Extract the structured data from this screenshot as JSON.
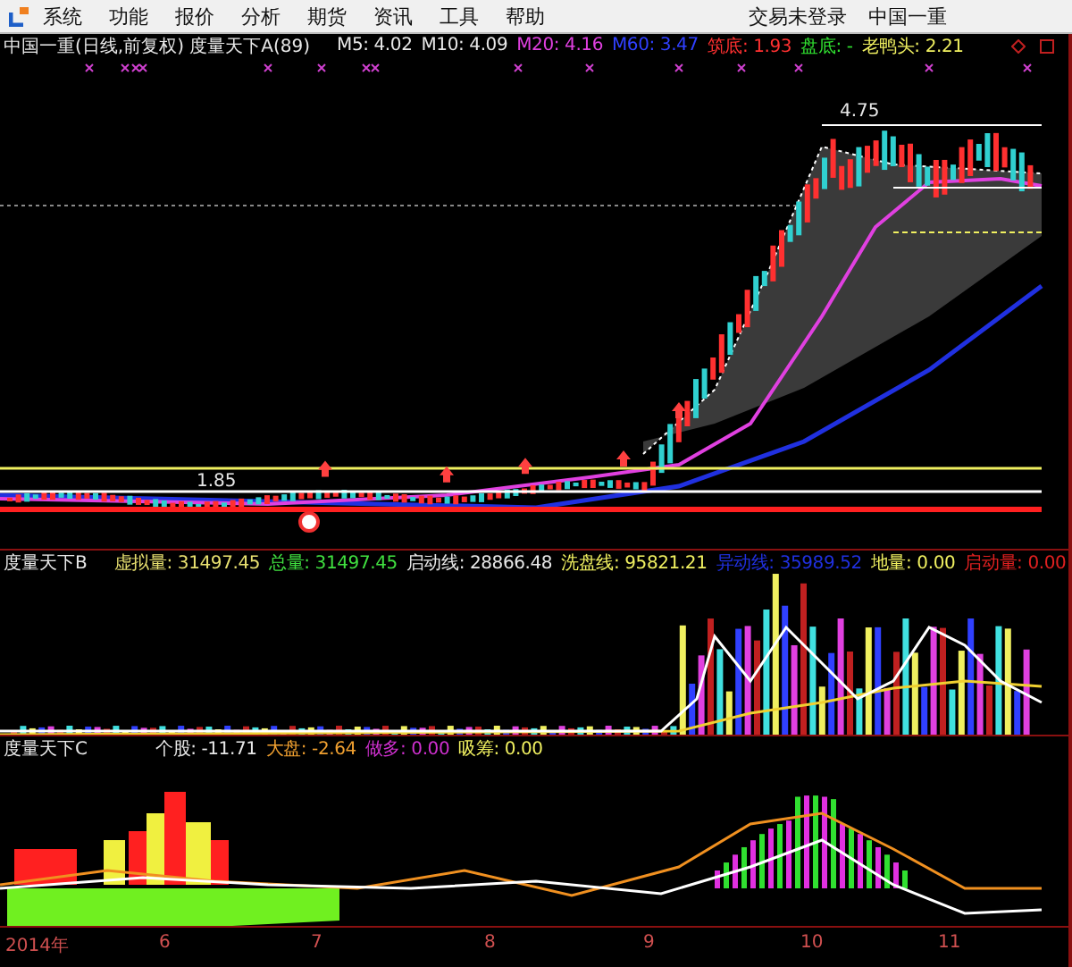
{
  "menu": {
    "items": [
      "系统",
      "功能",
      "报价",
      "分析",
      "期货",
      "资讯",
      "工具",
      "帮助"
    ],
    "status": "交易未登录",
    "stock": "中国一重"
  },
  "main_panel": {
    "title": "中国一重(日线,前复权) 度量天下A(89)",
    "legend": [
      {
        "text": "M5: 4.02",
        "color": "#e8e8e8"
      },
      {
        "text": "M10: 4.09",
        "color": "#e8e8e8"
      },
      {
        "text": "M20: 4.16",
        "color": "#e040e0"
      },
      {
        "text": "M60: 3.47",
        "color": "#3040ff"
      },
      {
        "text": "筑底: 1.93",
        "color": "#ff3030"
      },
      {
        "text": "盘底: -",
        "color": "#30e030"
      },
      {
        "text": "老鸭头: 2.21",
        "color": "#f0f060"
      }
    ],
    "price_labels": [
      "4.75",
      "1.85"
    ]
  },
  "volume_panel": {
    "title": "度量天下B",
    "legend": [
      {
        "text": "虚拟量: 31497.45",
        "color": "#e8e070"
      },
      {
        "text": "总量: 31497.45",
        "color": "#40e040"
      },
      {
        "text": "启动线: 28866.48",
        "color": "#e8e8e8"
      },
      {
        "text": "洗盘线: 95821.21",
        "color": "#f0f060"
      },
      {
        "text": "异动线: 35989.52",
        "color": "#2030e0"
      },
      {
        "text": "地量: 0.00",
        "color": "#f0f060"
      },
      {
        "text": "启动量: 0.00",
        "color": "#e02020"
      }
    ]
  },
  "indicator_panel": {
    "title": "度量天下C",
    "legend": [
      {
        "text": "个股: -11.71",
        "color": "#e8e8e8"
      },
      {
        "text": "大盘: -2.64",
        "color": "#f0a030"
      },
      {
        "text": "做多: 0.00",
        "color": "#d030d0"
      },
      {
        "text": "吸筹: 0.00",
        "color": "#f0f060"
      }
    ]
  },
  "time_axis": [
    "2014年",
    "6",
    "7",
    "8",
    "9",
    "10",
    "11"
  ]
}
